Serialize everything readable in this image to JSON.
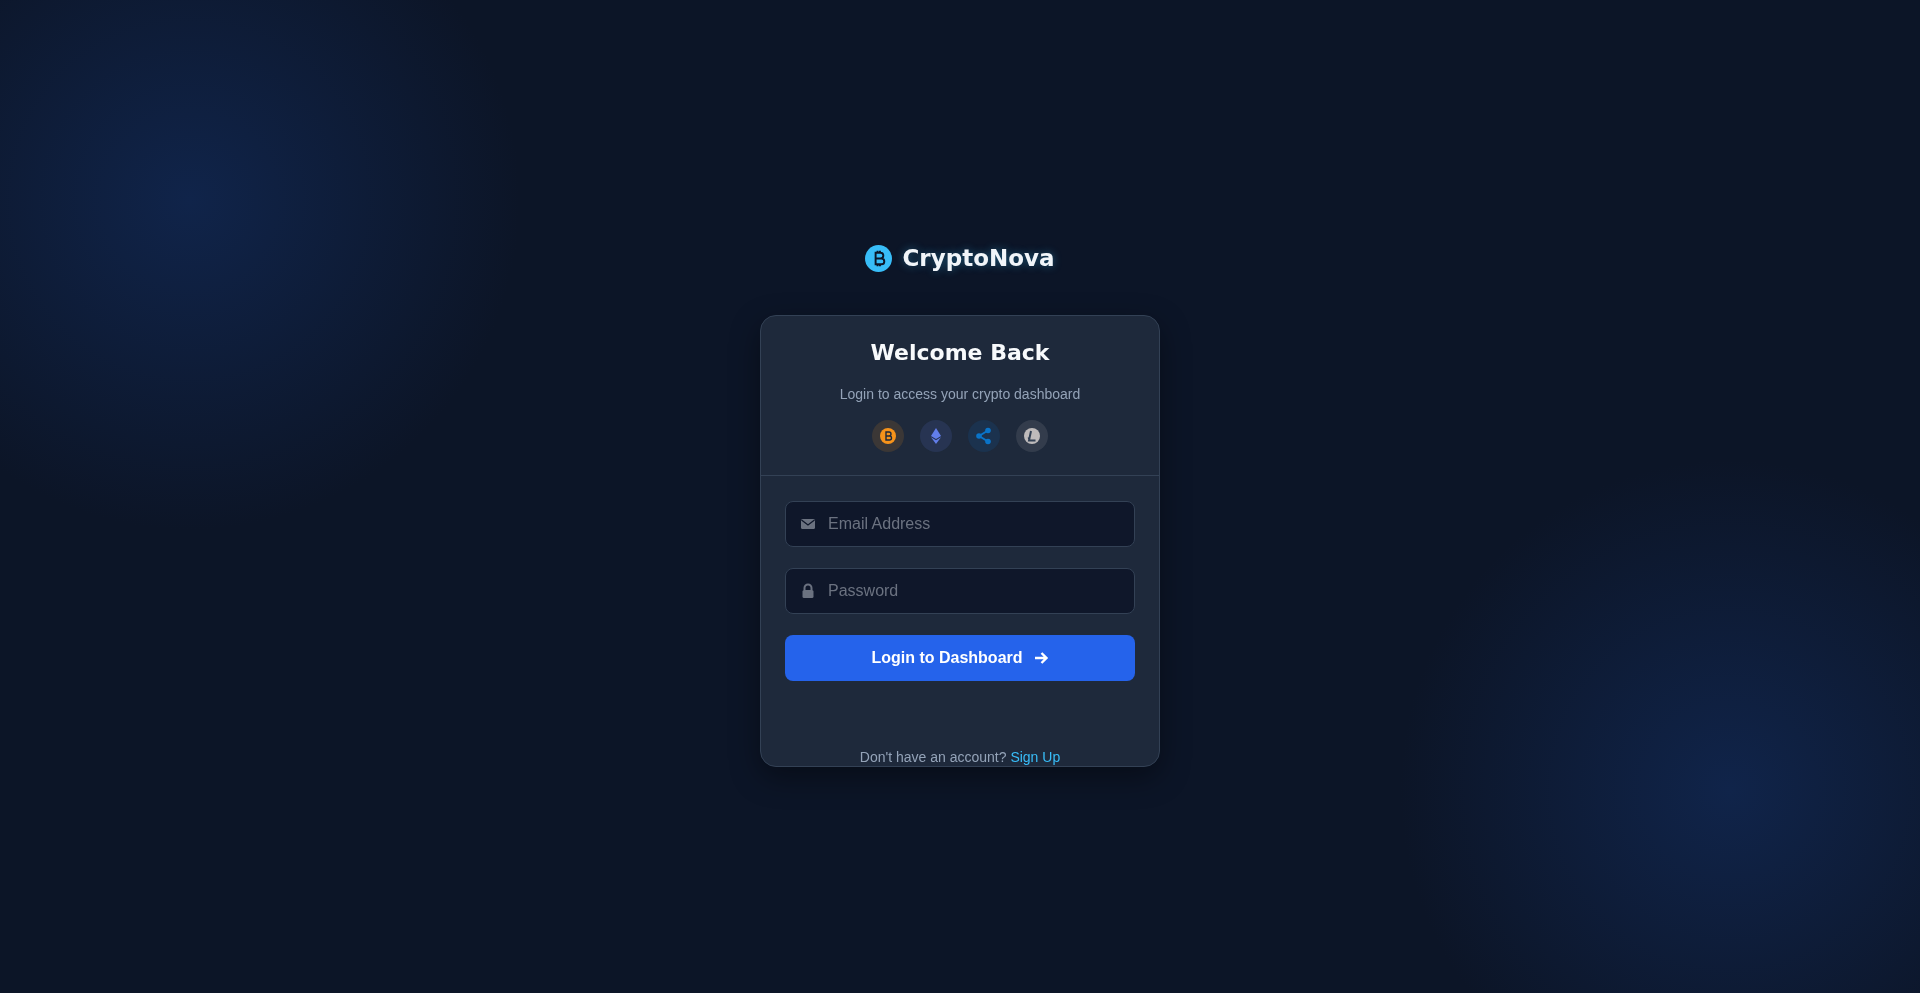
{
  "brand": {
    "name": "CryptoNova"
  },
  "card": {
    "title": "Welcome Back",
    "subtitle": "Login to access your crypto dashboard",
    "coins": [
      {
        "kind": "bitcoin",
        "color": "#f7931a"
      },
      {
        "kind": "ethereum",
        "color": "#627eea"
      },
      {
        "kind": "ripple",
        "color": "#0a74c9"
      },
      {
        "kind": "litecoin",
        "color": "#bfbbbb"
      }
    ],
    "fields": [
      {
        "kind": "email",
        "placeholder": "Email Address"
      },
      {
        "kind": "password",
        "placeholder": "Password"
      }
    ],
    "button": "Login to Dashboard",
    "footer": {
      "text": "Don't have an account?",
      "link": "Sign Up"
    }
  }
}
